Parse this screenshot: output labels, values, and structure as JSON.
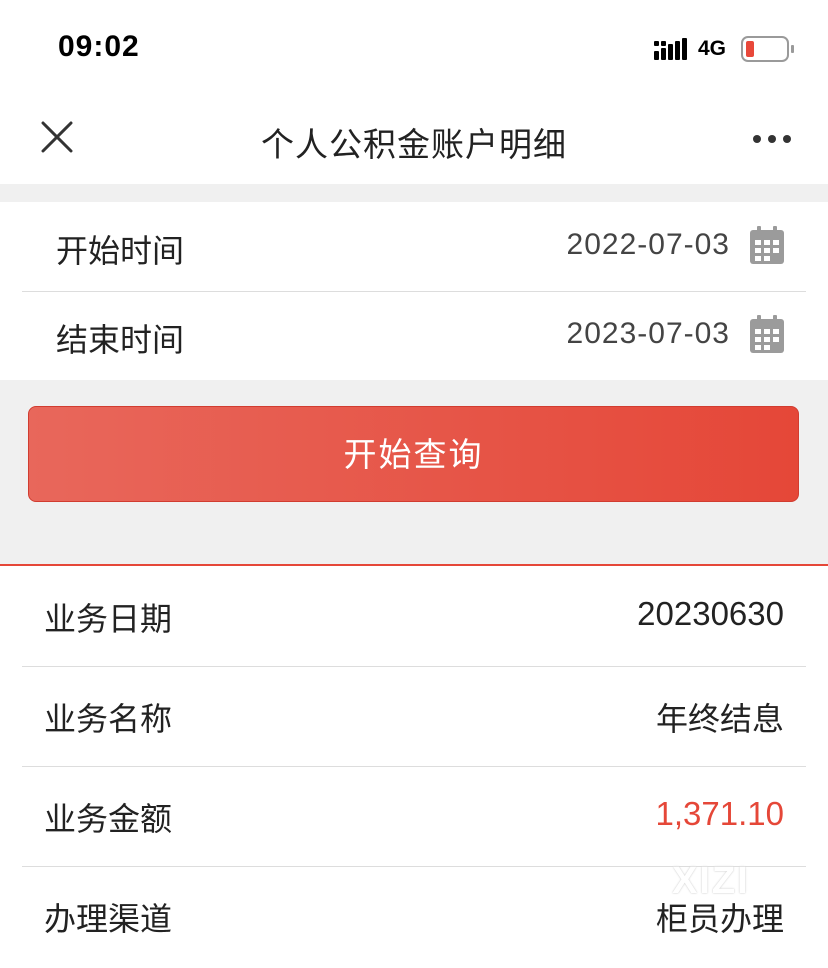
{
  "status_bar": {
    "time": "09:02",
    "network": "4G"
  },
  "nav": {
    "title": "个人公积金账户明细"
  },
  "query": {
    "start": {
      "label": "开始时间",
      "value": "2022-07-03"
    },
    "end": {
      "label": "结束时间",
      "value": "2023-07-03"
    },
    "button_label": "开始查询"
  },
  "details": [
    {
      "label": "业务日期",
      "value": "20230630"
    },
    {
      "label": "业务名称",
      "value": "年终结息"
    },
    {
      "label": "业务金额",
      "value": "1,371.10"
    },
    {
      "label": "办理渠道",
      "value": "柜员办理"
    }
  ],
  "watermark": "XIZI",
  "colors": {
    "accent": "#e54738",
    "battery_low": "#e8483a"
  }
}
